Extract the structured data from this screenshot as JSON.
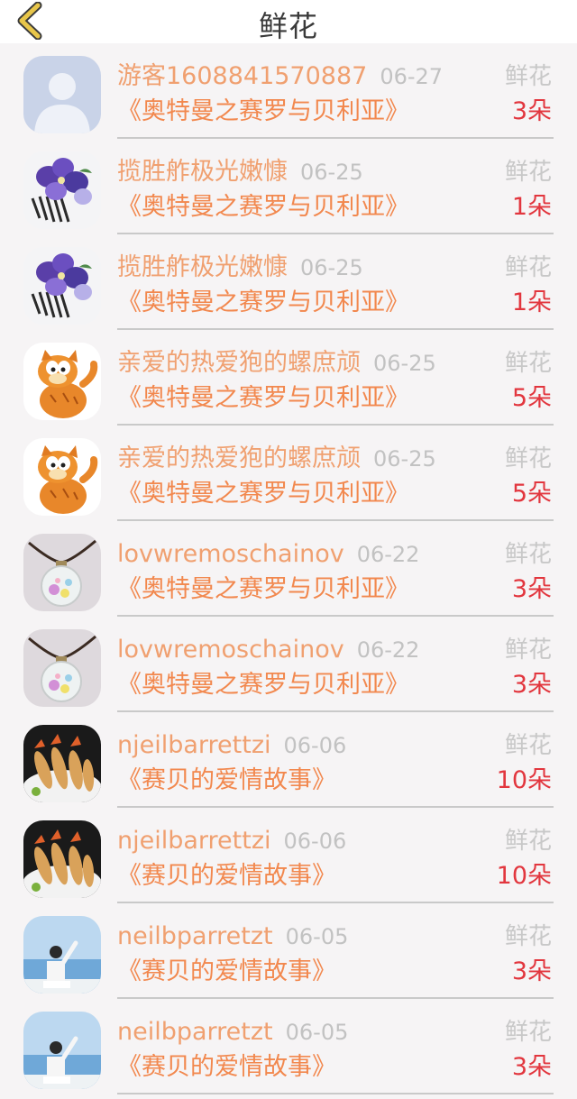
{
  "header": {
    "title": "鲜花",
    "back_icon": "chevron-left-icon",
    "back_color": "#e8c64a"
  },
  "colors": {
    "name": "#f0a070",
    "date": "#c2c2c2",
    "book": "#f2884e",
    "kind": "#c8c8c8",
    "count": "#e2363e"
  },
  "records": [
    {
      "avatar": "default-user-avatar",
      "name": "游客1608841570887",
      "date": "06-27",
      "book": "《奥特曼之赛罗与贝利亚》",
      "kind": "鲜花",
      "count": "3朵"
    },
    {
      "avatar": "flower-hairpin-avatar",
      "name": "揽胜舴极光嫩慷",
      "date": "06-25",
      "book": "《奥特曼之赛罗与贝利亚》",
      "kind": "鲜花",
      "count": "1朵"
    },
    {
      "avatar": "flower-hairpin-avatar",
      "name": "揽胜舴极光嫩慷",
      "date": "06-25",
      "book": "《奥特曼之赛罗与贝利亚》",
      "kind": "鲜花",
      "count": "1朵"
    },
    {
      "avatar": "garfield-cat-avatar",
      "name": "亲爱的热爱狍的螺庶颃",
      "date": "06-25",
      "book": "《奥特曼之赛罗与贝利亚》",
      "kind": "鲜花",
      "count": "5朵"
    },
    {
      "avatar": "garfield-cat-avatar",
      "name": "亲爱的热爱狍的螺庶颃",
      "date": "06-25",
      "book": "《奥特曼之赛罗与贝利亚》",
      "kind": "鲜花",
      "count": "5朵"
    },
    {
      "avatar": "glass-pendant-avatar",
      "name": "lovwremoschainov",
      "date": "06-22",
      "book": "《奥特曼之赛罗与贝利亚》",
      "kind": "鲜花",
      "count": "3朵"
    },
    {
      "avatar": "glass-pendant-avatar",
      "name": "lovwremoschainov",
      "date": "06-22",
      "book": "《奥特曼之赛罗与贝利亚》",
      "kind": "鲜花",
      "count": "3朵"
    },
    {
      "avatar": "fried-shrimp-avatar",
      "name": "njeilbarrettzi",
      "date": "06-06",
      "book": "《赛贝的爱情故事》",
      "kind": "鲜花",
      "count": "10朵"
    },
    {
      "avatar": "fried-shrimp-avatar",
      "name": "njeilbarrettzi",
      "date": "06-06",
      "book": "《赛贝的爱情故事》",
      "kind": "鲜花",
      "count": "10朵"
    },
    {
      "avatar": "seaside-man-avatar",
      "name": "neilbparretzt",
      "date": "06-05",
      "book": "《赛贝的爱情故事》",
      "kind": "鲜花",
      "count": "3朵"
    },
    {
      "avatar": "seaside-man-avatar",
      "name": "neilbparretzt",
      "date": "06-05",
      "book": "《赛贝的爱情故事》",
      "kind": "鲜花",
      "count": "3朵"
    }
  ]
}
